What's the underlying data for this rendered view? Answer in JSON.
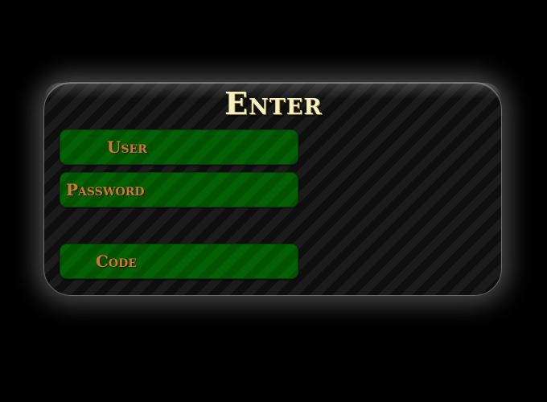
{
  "login": {
    "title": "Enter",
    "fields": {
      "user_label": "User",
      "password_label": "Password",
      "code_label": "Code"
    }
  },
  "colors": {
    "background": "#000000",
    "panel_stripe_light": "#1b1b1b",
    "panel_stripe_dark": "#0e0e0e",
    "field_green": "#046004",
    "label_orange": "#c87a30",
    "title_cream": "#f5f0c0"
  }
}
